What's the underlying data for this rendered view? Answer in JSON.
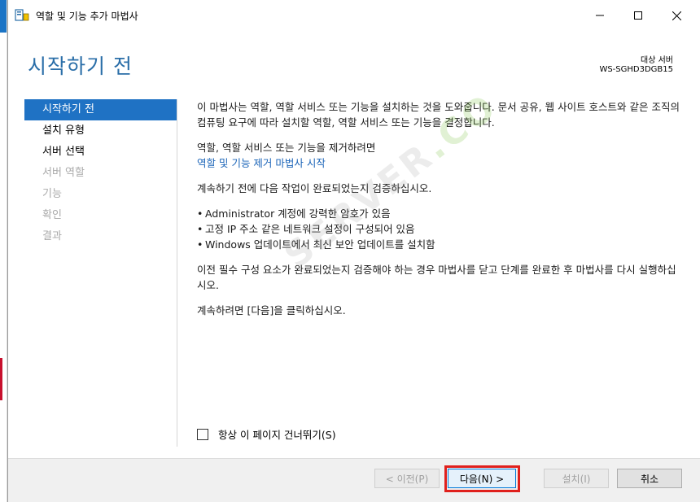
{
  "window": {
    "title": "역할 및 기능 추가 마법사",
    "controls": {
      "minimize": "—",
      "maximize": "☐",
      "close": "✕"
    }
  },
  "header": {
    "page_title": "시작하기 전",
    "target_label": "대상 서버",
    "target_name": "WS-SGHD3DGB15"
  },
  "nav": {
    "items": [
      {
        "label": "시작하기 전",
        "state": "active"
      },
      {
        "label": "설치 유형",
        "state": "enabled"
      },
      {
        "label": "서버 선택",
        "state": "enabled"
      },
      {
        "label": "서버 역할",
        "state": "disabled"
      },
      {
        "label": "기능",
        "state": "disabled"
      },
      {
        "label": "확인",
        "state": "disabled"
      },
      {
        "label": "결과",
        "state": "disabled"
      }
    ]
  },
  "content": {
    "intro": "이 마법사는 역할, 역할 서비스 또는 기능을 설치하는 것을 도와줍니다. 문서 공유, 웹 사이트 호스트와 같은 조직의 컴퓨팅 요구에 따라 설치할 역할, 역할 서비스 또는 기능을 결정합니다.",
    "remove_prompt": "역할, 역할 서비스 또는 기능을 제거하려면",
    "remove_link": "역할 및 기능 제거 마법사 시작",
    "verify_prompt": "계속하기 전에 다음 작업이 완료되었는지 검증하십시오.",
    "checklist": [
      "Administrator 계정에 강력한 암호가 있음",
      "고정 IP 주소 같은 네트워크 설정이 구성되어 있음",
      "Windows 업데이트에서 최신 보안 업데이트를 설치함"
    ],
    "prereq_note": "이전 필수 구성 요소가 완료되었는지 검증해야 하는 경우 마법사를 닫고 단계를 완료한 후 마법사를 다시 실행하십시오.",
    "continue_note": "계속하려면 [다음]을 클릭하십시오."
  },
  "skip_checkbox": {
    "label": "항상 이 페이지 건너뛰기(S)",
    "checked": false
  },
  "footer": {
    "prev_label": "< 이전(P)",
    "next_label": "다음(N) >",
    "install_label": "설치(I)",
    "cancel_label": "취소"
  },
  "watermark": {
    "text_main": "SERVER",
    "text_accent": ".CO"
  },
  "colors": {
    "accent": "#1f72c4",
    "title": "#2a6ea8",
    "link": "#1a64b8",
    "highlight": "#e0201c"
  }
}
